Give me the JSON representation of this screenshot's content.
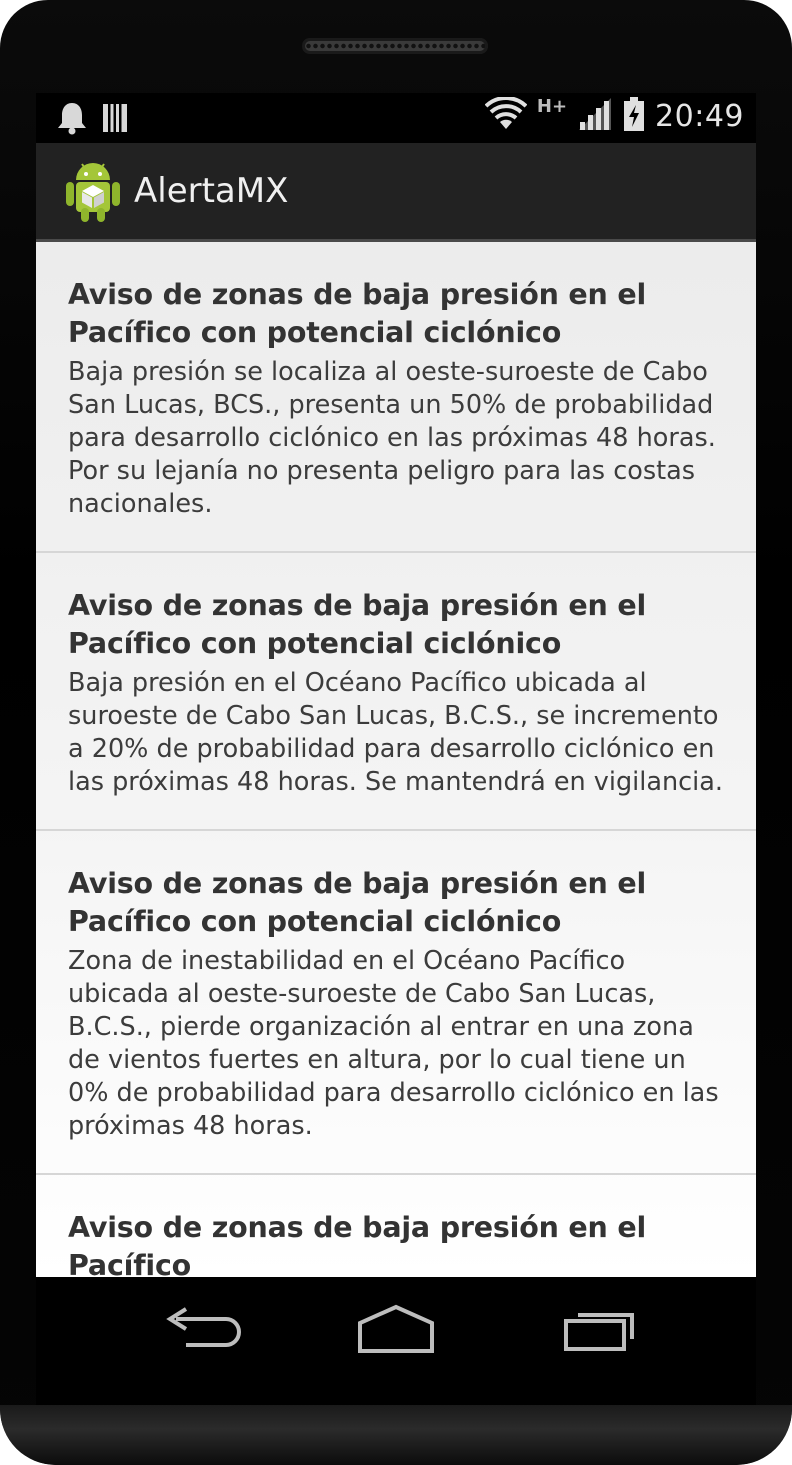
{
  "status_bar": {
    "time": "20:49",
    "network_type": "H+",
    "icons": [
      "notification-bell-icon",
      "storage-icon",
      "wifi-icon",
      "cell-signal-icon",
      "battery-charging-icon"
    ]
  },
  "action_bar": {
    "title": "AlertaMX",
    "icon": "android-app-icon"
  },
  "alerts": [
    {
      "title": "Aviso de zonas de baja presión en el Pacífico con potencial ciclónico",
      "body": "Baja presión se localiza al oeste-suroeste de Cabo San Lucas, BCS., presenta un 50% de probabilidad para desarrollo ciclónico en las próximas 48 horas. Por su lejanía no presenta peligro para las costas nacionales."
    },
    {
      "title": "Aviso de zonas de baja presión en el Pacífico con potencial ciclónico",
      "body": "Baja presión en el Océano Pacífico ubicada al suroeste de Cabo San Lucas, B.C.S., se incremento a 20% de probabilidad para desarrollo ciclónico en las próximas 48 horas. Se mantendrá en vigilancia."
    },
    {
      "title": "Aviso de zonas de baja presión en el Pacífico con potencial ciclónico",
      "body": "Zona de inestabilidad en el Océano Pacífico ubicada al oeste-suroeste de Cabo San Lucas, B.C.S., pierde organización al entrar en una zona de vientos fuertes en altura, por lo cual tiene un 0% de probabilidad para desarrollo ciclónico en las próximas 48 horas."
    },
    {
      "title": "Aviso de zonas de baja presión en el Pacífico",
      "body": ""
    }
  ],
  "nav_bar": {
    "icons": [
      "back-icon",
      "home-icon",
      "recent-apps-icon"
    ]
  },
  "colors": {
    "action_bar_bg": "#222222",
    "list_bg": "#f0f0f0",
    "title_text": "#333333",
    "body_text": "#3c3c3c",
    "android_green": "#a4c639"
  }
}
